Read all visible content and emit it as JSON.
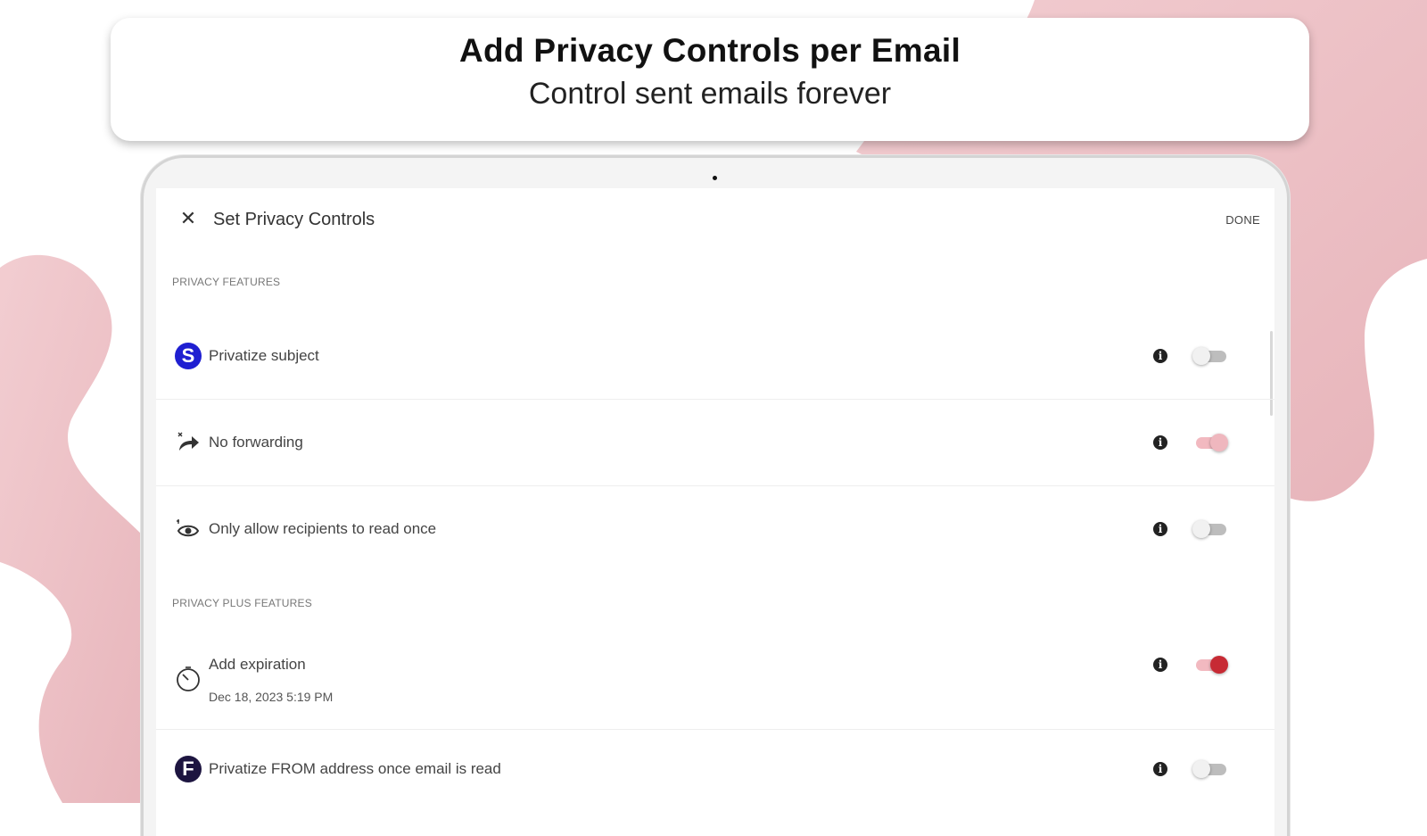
{
  "header": {
    "title": "Add Privacy Controls per Email",
    "subtitle": "Control sent emails forever"
  },
  "appbar": {
    "close_icon": "close-icon",
    "title": "Set Privacy Controls",
    "done_label": "DONE"
  },
  "sections": {
    "privacy_features": "PRIVACY FEATURES",
    "privacy_plus_features": "PRIVACY PLUS FEATURES"
  },
  "rows": [
    {
      "label": "Privatize subject",
      "icon": "privatize-subject-icon",
      "icon_letter": "S",
      "toggle_on": false
    },
    {
      "label": "No forwarding",
      "icon": "no-forward-icon",
      "toggle_on": true
    },
    {
      "label": "Only allow recipients to read once",
      "icon": "eye-icon",
      "toggle_on": false
    },
    {
      "label": "Add expiration",
      "sublabel": "Dec 18, 2023 5:19 PM",
      "icon": "timer-icon",
      "toggle_on": true
    },
    {
      "label": "Privatize FROM address once email is read",
      "icon": "privatize-from-icon",
      "icon_letter": "F",
      "toggle_on": false
    }
  ],
  "info_icon_glyph": "i",
  "colors": {
    "accent_red": "#c72a34",
    "accent_pink": "#f2b9c0",
    "subject_icon_blue": "#1f1fd1",
    "from_icon_navy": "#1d1540",
    "background_blob": "#e9bcc1"
  }
}
